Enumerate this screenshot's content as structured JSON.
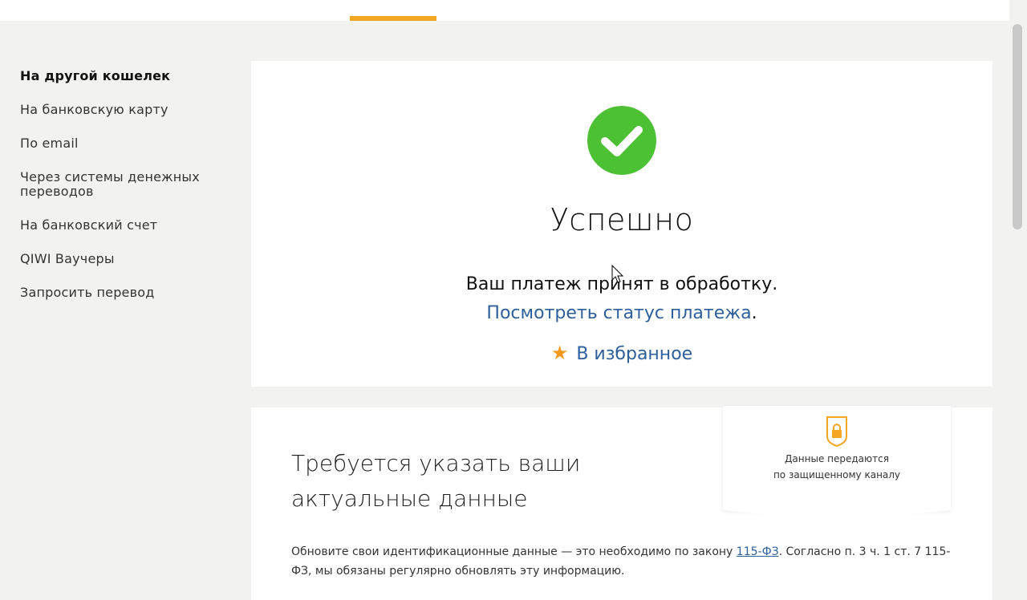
{
  "sidebar": {
    "items": [
      {
        "label": "На другой кошелек",
        "active": true
      },
      {
        "label": "На банковскую карту"
      },
      {
        "label": "По email"
      },
      {
        "label": "Через системы денежных переводов"
      },
      {
        "label": "На банковский счет"
      },
      {
        "label": "QIWI Ваучеры"
      },
      {
        "label": "Запросить перевод"
      }
    ]
  },
  "success": {
    "title": "Успешно",
    "message": "Ваш платеж принят в обработку.",
    "status_link": "Посмотреть статус платежа",
    "status_suffix": ".",
    "favorite_label": "В избранное"
  },
  "data_card": {
    "title": "Требуется указать ваши актуальные данные",
    "secure_line1": "Данные передаются",
    "secure_line2": "по защищенному каналу",
    "desc_before": "Обновите свои идентификационные данные — это необходимо по закону ",
    "law_link": "115-ФЗ",
    "desc_after": ". Согласно п. 3 ч. 1 ст. 7 115-ФЗ, мы обязаны регулярно обновлять эту информацию."
  },
  "colors": {
    "accent": "#f5a623",
    "success_green": "#4cc133",
    "link_blue": "#2d5f9a",
    "star_orange": "#f39a1e"
  },
  "icons": {
    "success": "checkmark-icon",
    "favorite": "star-icon",
    "secure": "shield-lock-icon"
  }
}
